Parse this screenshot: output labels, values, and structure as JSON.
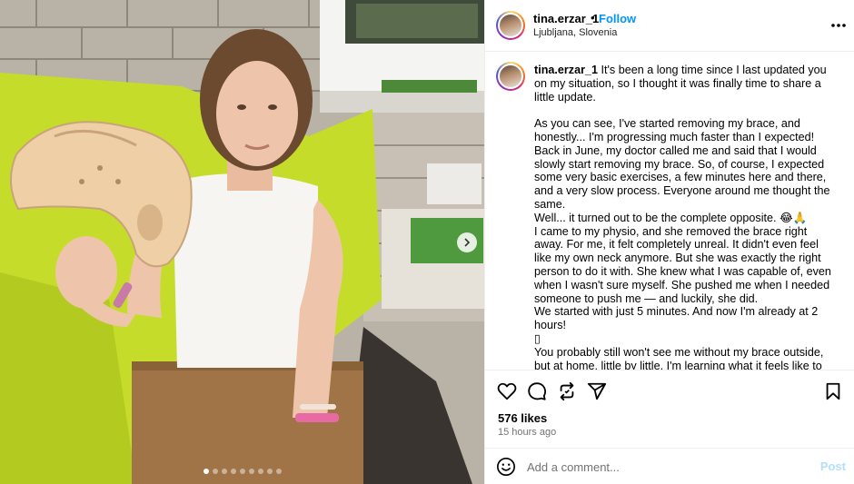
{
  "post": {
    "author": {
      "username": "tina.erzar_1",
      "separator": "•",
      "follow_label": "Follow",
      "location": "Ljubljana, Slovenia"
    },
    "media": {
      "current_index": 1,
      "total": 9
    },
    "caption": {
      "username": "tina.erzar_1",
      "text": " It's been a long time since I last updated you on my situation, so I thought it was finally time to share a little update.\n\nAs you can see, I've started removing my brace, and honestly... I'm progressing much faster than I expected!\nBack in June, my doctor called me and said that I would slowly start removing my brace. So, of course, I expected some very basic exercises, a few minutes here and there, and a very slow process. Everyone around me thought the same.\nWell... it turned out to be the complete opposite. 😂🙏\nI came to my physio, and she removed the brace right away. For me, it felt completely unreal. It didn't even feel like my own neck anymore. But she was exactly the right person to do it with. She knew what I was capable of, even when I wasn't sure myself. She pushed me when I needed someone to push me — and luckily, she did.\nWe started with just 5 minutes. And now I'm already at 2 hours!\n▯\nYou probably still won't see me without my brace outside, but at home, little by little, I'm learning what it feels like to have a small piece of my old life back.\nAnd honestly... that feeling is something I can't even put into words."
    },
    "likes": "576 likes",
    "timestamp": "15 hours ago",
    "comment": {
      "placeholder": "Add a comment...",
      "post_label": "Post"
    },
    "icons": {
      "like": "heart-icon",
      "comment": "comment-bubble-icon",
      "repost": "repost-icon",
      "share": "send-icon",
      "save": "bookmark-icon",
      "more": "more-dots-icon",
      "next": "chevron-right-icon",
      "emoji": "emoji-icon"
    },
    "colors": {
      "link_blue": "#0095f6",
      "post_disabled": "#b2dffc",
      "secondary_text": "#737373"
    }
  }
}
